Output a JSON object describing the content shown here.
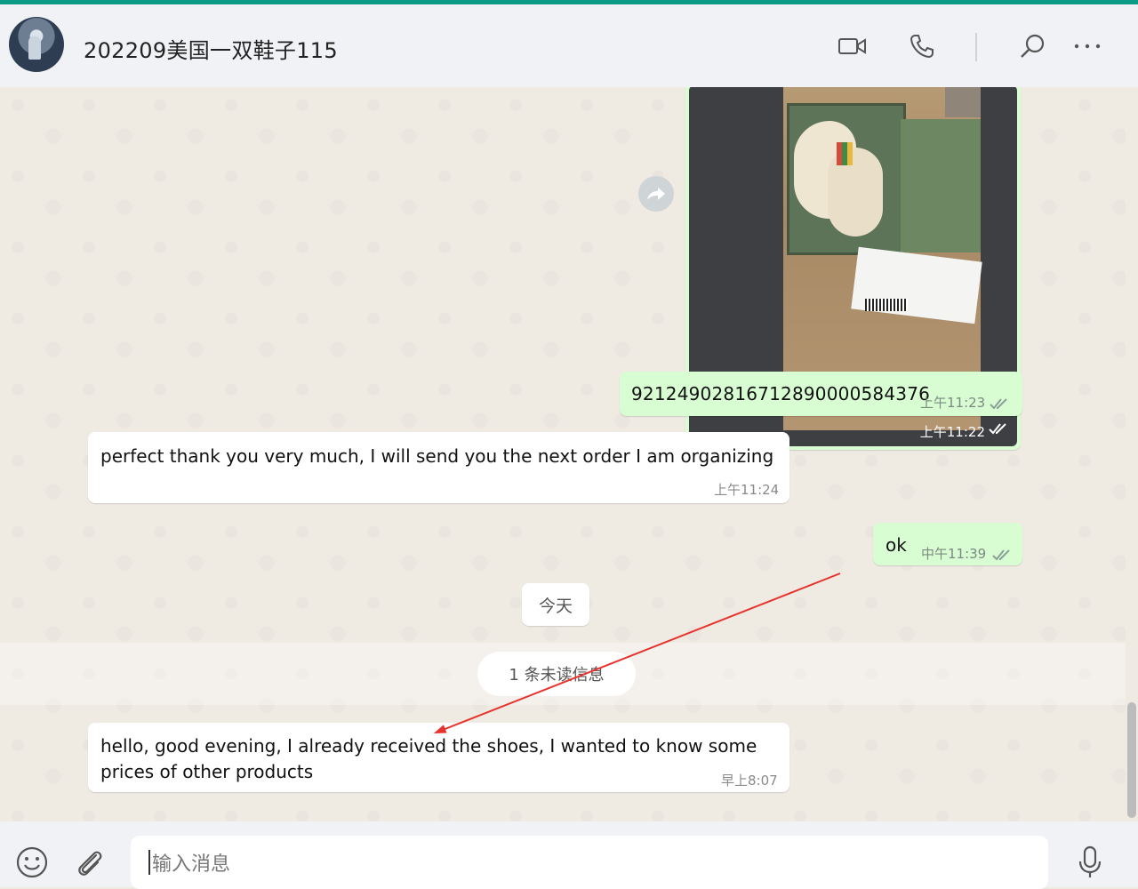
{
  "header": {
    "title": "202209美国一双鞋子115"
  },
  "messages": {
    "image_time": "上午11:22",
    "tracking_text": "9212490281671289000058437​6",
    "tracking_time": "上午11:23",
    "reply1_text": "perfect thank you very much, I will send you the next order I am organizing",
    "reply1_time": "上午11:24",
    "ok_text": "ok",
    "ok_time": "中午11:39",
    "date_label": "今天",
    "unread_label": "1 条未读信息",
    "last_line1": "hello, good evening, I already received the shoes, I wanted to know some",
    "last_line2": "prices of other products",
    "last_time": "早上8:07"
  },
  "composer": {
    "placeholder": "输入消息"
  },
  "colors": {
    "accent": "#0a9c84",
    "outgoing_bubble": "#d9fdd3",
    "incoming_bubble": "#ffffff",
    "annotation_arrow": "#e8322d",
    "read_ticks": "#7a8a80"
  },
  "icons": [
    "video-call-icon",
    "voice-call-icon",
    "search-icon",
    "more-options-icon",
    "forward-icon",
    "emoji-icon",
    "attach-icon",
    "microphone-icon",
    "double-check-icon"
  ]
}
